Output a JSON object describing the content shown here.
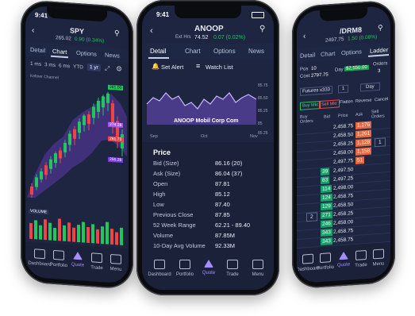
{
  "left_phone": {
    "status_time": "9:41",
    "symbol": "SPY",
    "price": "265.02",
    "change": "0.90 (0.34%)",
    "tabs": [
      "Detail",
      "Chart",
      "Options",
      "News"
    ],
    "ranges": [
      "1 ms",
      "3 ms",
      "6 ms",
      "YTD",
      "1 yr"
    ],
    "indicator_label": "Keltner Channel",
    "price_badges": [
      "281.00",
      "274.28",
      "261.73",
      "255.28"
    ],
    "volume_label": "VOLUME",
    "nav": [
      "Dashboard",
      "Portfolio",
      "Quote",
      "Trade",
      "Menu"
    ],
    "colors": {
      "up": "#22c55e",
      "down": "#ef4444",
      "band": "#5b3aa8"
    }
  },
  "center_phone": {
    "status_time": "9:41",
    "symbol": "ANOOP",
    "ext_label": "Ext Hrs",
    "price": "74.52",
    "change": "0.07 (0.02%)",
    "tabs": [
      "Detail",
      "Chart",
      "Options",
      "News"
    ],
    "set_alert": "Set Alert",
    "watch_list": "Watch List",
    "chart_name": "ANOOP Mobil Corp Com",
    "x_labels": [
      "Sep",
      "Oct",
      "Nov"
    ],
    "y_labels": [
      "85.75",
      "85.50",
      "85.25",
      "85",
      "85.25"
    ],
    "section_title": "Price",
    "rows": [
      {
        "label": "Bid (Size)",
        "value": "86.16 (20)"
      },
      {
        "label": "Ask (Size)",
        "value": "86.04 (37)"
      },
      {
        "label": "Open",
        "value": "87.81"
      },
      {
        "label": "High",
        "value": "85.12"
      },
      {
        "label": "Low",
        "value": "87.40"
      },
      {
        "label": "Previous Close",
        "value": "87.85"
      },
      {
        "label": "52 Week Range",
        "value": "62.21 - 89.40"
      },
      {
        "label": "Volume",
        "value": "87.85M"
      },
      {
        "label": "10-Day Avg Volume",
        "value": "92.33M"
      }
    ],
    "nav": [
      "Dashboard",
      "Portfolio",
      "Quote",
      "Trade",
      "Menu"
    ]
  },
  "right_phone": {
    "symbol": "/DRM8",
    "price": "2497.75",
    "change": "1.50 (0.08%)",
    "tabs": [
      "Detail",
      "Chart",
      "Options",
      "Ladder"
    ],
    "pos_label": "Pos",
    "pos_value": "10",
    "cost_label": "Cost",
    "cost_value": "2797.75",
    "day_pl_label": "Day",
    "day_pl_value": "$2,550.00",
    "orders_label": "Orders",
    "orders_value": "3",
    "futures_select": "Futures x333",
    "qty": "1",
    "tif": "Day",
    "buttons": [
      "Buy Mkt",
      "Sell Mkt",
      "Flatten",
      "Reverse",
      "Cancel"
    ],
    "col_headers": [
      "Buy Orders",
      "Bid",
      "Price",
      "Ask",
      "Sell Orders"
    ],
    "ladder": [
      {
        "price": "2,458.75",
        "ask": "1,176"
      },
      {
        "price": "2,458.50",
        "ask": "1,261"
      },
      {
        "price": "2,458.25",
        "ask": "1,128"
      },
      {
        "price": "2,458.00",
        "ask": "1,158"
      },
      {
        "price": "2,497.75",
        "ask": "51"
      },
      {
        "price": "2,497.50",
        "bid": "39"
      },
      {
        "price": "2,497.25",
        "bid": "83"
      },
      {
        "price": "2,498.00",
        "bid": "114"
      },
      {
        "price": "2,458.75",
        "bid": "124"
      },
      {
        "price": "2,458.50",
        "bid": "129"
      },
      {
        "price": "2,458.25",
        "bid": "271"
      },
      {
        "price": "2,458.00",
        "bid": "246"
      },
      {
        "price": "2,458.75",
        "bid": "343"
      },
      {
        "price": "2,458.75",
        "bid": "343"
      }
    ],
    "sell_order_value": "1",
    "buy_order_value": "2",
    "nav": [
      "Dashboard",
      "Portfolio",
      "Quote",
      "Trade",
      "Menu"
    ]
  }
}
